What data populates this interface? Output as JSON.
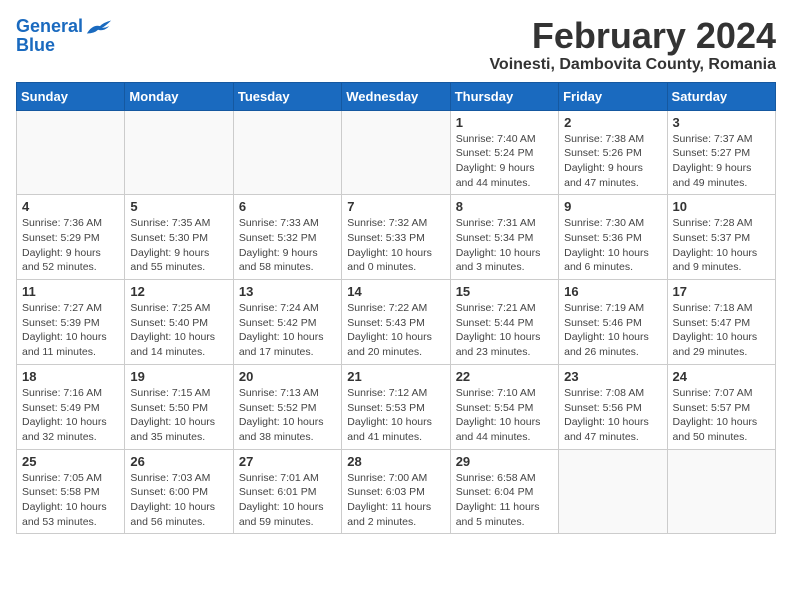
{
  "logo": {
    "line1": "General",
    "line2": "Blue"
  },
  "title": "February 2024",
  "subtitle": "Voinesti, Dambovita County, Romania",
  "weekdays": [
    "Sunday",
    "Monday",
    "Tuesday",
    "Wednesday",
    "Thursday",
    "Friday",
    "Saturday"
  ],
  "weeks": [
    [
      {
        "day": "",
        "info": ""
      },
      {
        "day": "",
        "info": ""
      },
      {
        "day": "",
        "info": ""
      },
      {
        "day": "",
        "info": ""
      },
      {
        "day": "1",
        "info": "Sunrise: 7:40 AM\nSunset: 5:24 PM\nDaylight: 9 hours\nand 44 minutes."
      },
      {
        "day": "2",
        "info": "Sunrise: 7:38 AM\nSunset: 5:26 PM\nDaylight: 9 hours\nand 47 minutes."
      },
      {
        "day": "3",
        "info": "Sunrise: 7:37 AM\nSunset: 5:27 PM\nDaylight: 9 hours\nand 49 minutes."
      }
    ],
    [
      {
        "day": "4",
        "info": "Sunrise: 7:36 AM\nSunset: 5:29 PM\nDaylight: 9 hours\nand 52 minutes."
      },
      {
        "day": "5",
        "info": "Sunrise: 7:35 AM\nSunset: 5:30 PM\nDaylight: 9 hours\nand 55 minutes."
      },
      {
        "day": "6",
        "info": "Sunrise: 7:33 AM\nSunset: 5:32 PM\nDaylight: 9 hours\nand 58 minutes."
      },
      {
        "day": "7",
        "info": "Sunrise: 7:32 AM\nSunset: 5:33 PM\nDaylight: 10 hours\nand 0 minutes."
      },
      {
        "day": "8",
        "info": "Sunrise: 7:31 AM\nSunset: 5:34 PM\nDaylight: 10 hours\nand 3 minutes."
      },
      {
        "day": "9",
        "info": "Sunrise: 7:30 AM\nSunset: 5:36 PM\nDaylight: 10 hours\nand 6 minutes."
      },
      {
        "day": "10",
        "info": "Sunrise: 7:28 AM\nSunset: 5:37 PM\nDaylight: 10 hours\nand 9 minutes."
      }
    ],
    [
      {
        "day": "11",
        "info": "Sunrise: 7:27 AM\nSunset: 5:39 PM\nDaylight: 10 hours\nand 11 minutes."
      },
      {
        "day": "12",
        "info": "Sunrise: 7:25 AM\nSunset: 5:40 PM\nDaylight: 10 hours\nand 14 minutes."
      },
      {
        "day": "13",
        "info": "Sunrise: 7:24 AM\nSunset: 5:42 PM\nDaylight: 10 hours\nand 17 minutes."
      },
      {
        "day": "14",
        "info": "Sunrise: 7:22 AM\nSunset: 5:43 PM\nDaylight: 10 hours\nand 20 minutes."
      },
      {
        "day": "15",
        "info": "Sunrise: 7:21 AM\nSunset: 5:44 PM\nDaylight: 10 hours\nand 23 minutes."
      },
      {
        "day": "16",
        "info": "Sunrise: 7:19 AM\nSunset: 5:46 PM\nDaylight: 10 hours\nand 26 minutes."
      },
      {
        "day": "17",
        "info": "Sunrise: 7:18 AM\nSunset: 5:47 PM\nDaylight: 10 hours\nand 29 minutes."
      }
    ],
    [
      {
        "day": "18",
        "info": "Sunrise: 7:16 AM\nSunset: 5:49 PM\nDaylight: 10 hours\nand 32 minutes."
      },
      {
        "day": "19",
        "info": "Sunrise: 7:15 AM\nSunset: 5:50 PM\nDaylight: 10 hours\nand 35 minutes."
      },
      {
        "day": "20",
        "info": "Sunrise: 7:13 AM\nSunset: 5:52 PM\nDaylight: 10 hours\nand 38 minutes."
      },
      {
        "day": "21",
        "info": "Sunrise: 7:12 AM\nSunset: 5:53 PM\nDaylight: 10 hours\nand 41 minutes."
      },
      {
        "day": "22",
        "info": "Sunrise: 7:10 AM\nSunset: 5:54 PM\nDaylight: 10 hours\nand 44 minutes."
      },
      {
        "day": "23",
        "info": "Sunrise: 7:08 AM\nSunset: 5:56 PM\nDaylight: 10 hours\nand 47 minutes."
      },
      {
        "day": "24",
        "info": "Sunrise: 7:07 AM\nSunset: 5:57 PM\nDaylight: 10 hours\nand 50 minutes."
      }
    ],
    [
      {
        "day": "25",
        "info": "Sunrise: 7:05 AM\nSunset: 5:58 PM\nDaylight: 10 hours\nand 53 minutes."
      },
      {
        "day": "26",
        "info": "Sunrise: 7:03 AM\nSunset: 6:00 PM\nDaylight: 10 hours\nand 56 minutes."
      },
      {
        "day": "27",
        "info": "Sunrise: 7:01 AM\nSunset: 6:01 PM\nDaylight: 10 hours\nand 59 minutes."
      },
      {
        "day": "28",
        "info": "Sunrise: 7:00 AM\nSunset: 6:03 PM\nDaylight: 11 hours\nand 2 minutes."
      },
      {
        "day": "29",
        "info": "Sunrise: 6:58 AM\nSunset: 6:04 PM\nDaylight: 11 hours\nand 5 minutes."
      },
      {
        "day": "",
        "info": ""
      },
      {
        "day": "",
        "info": ""
      }
    ]
  ]
}
